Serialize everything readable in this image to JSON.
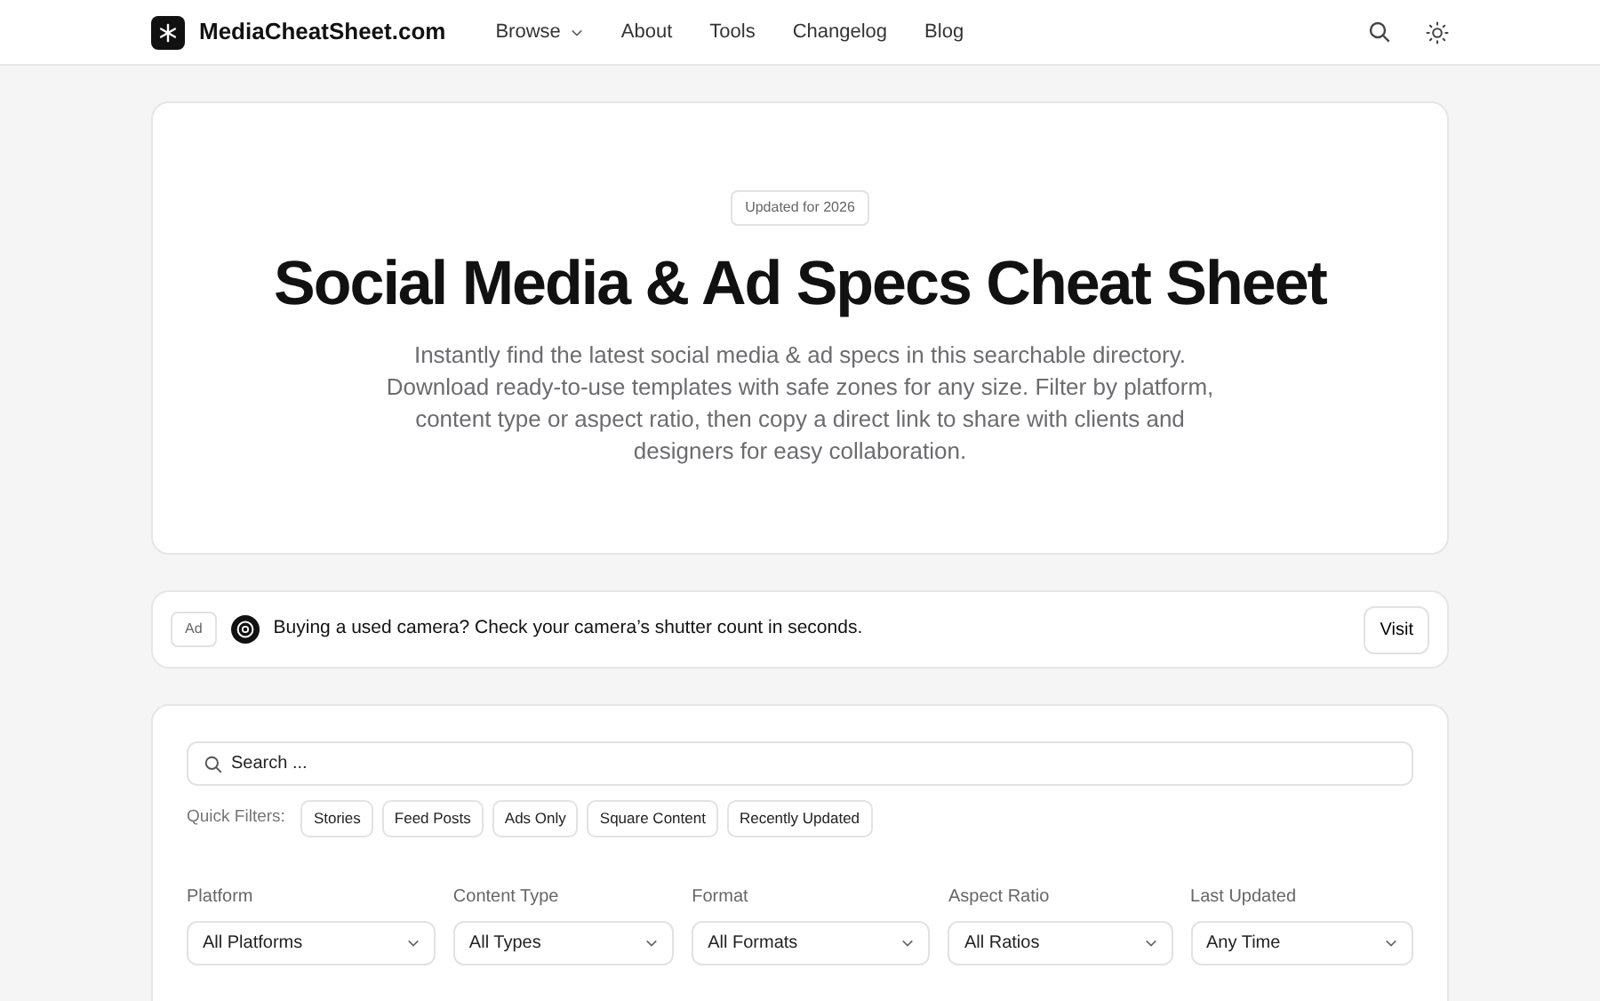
{
  "navbar": {
    "brand": "MediaCheatSheet.com",
    "links": [
      {
        "label": "Browse",
        "dropdown": true
      },
      {
        "label": "About",
        "dropdown": false
      },
      {
        "label": "Tools",
        "dropdown": false
      },
      {
        "label": "Changelog",
        "dropdown": false
      },
      {
        "label": "Blog",
        "dropdown": false
      }
    ]
  },
  "hero": {
    "badge": "Updated for 2026",
    "title": "Social Media & Ad Specs Cheat Sheet",
    "description": "Instantly find the latest social media & ad specs in this searchable directory. Download ready-to-use templates with safe zones for any size. Filter by platform, content type or aspect ratio, then copy a direct link to share with clients and designers for easy collaboration."
  },
  "ad": {
    "tag": "Ad",
    "text": "Buying a used camera? Check your camera’s shutter count in seconds.",
    "button": "Visit"
  },
  "search": {
    "placeholder": "Search ..."
  },
  "quick_filters": {
    "label": "Quick Filters:",
    "items": [
      {
        "label": "Stories",
        "selected": false
      },
      {
        "label": "Feed Posts",
        "selected": false
      },
      {
        "label": "Ads Only",
        "selected": false
      },
      {
        "label": "Square Content",
        "selected": false
      },
      {
        "label": "Recently Updated",
        "selected": false
      }
    ]
  },
  "filters": [
    {
      "label": "Platform",
      "value": "All Platforms"
    },
    {
      "label": "Content Type",
      "value": "All Types"
    },
    {
      "label": "Format",
      "value": "All Formats"
    },
    {
      "label": "Aspect Ratio",
      "value": "All Ratios"
    },
    {
      "label": "Last Updated",
      "value": "Any Time"
    }
  ]
}
